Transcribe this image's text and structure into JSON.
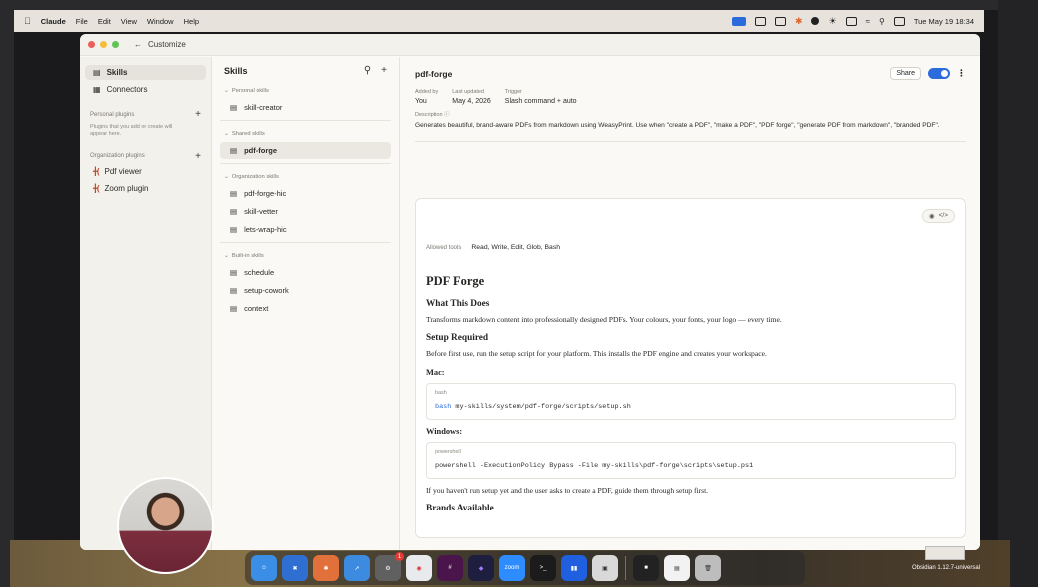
{
  "menubar": {
    "app_name": "Claude",
    "items": [
      "File",
      "Edit",
      "View",
      "Window",
      "Help"
    ],
    "clock": "Tue May 19  18:34"
  },
  "window": {
    "back_label": "Customize"
  },
  "nav": {
    "items": [
      {
        "label": "Skills",
        "icon": "skills-icon",
        "active": true
      },
      {
        "label": "Connectors",
        "icon": "connectors-icon",
        "active": false
      }
    ],
    "personal_plugins_label": "Personal plugins",
    "personal_plugins_note": "Plugins that you add or create will appear here.",
    "org_plugins_label": "Organization plugins",
    "org_plugins": [
      "Pdf viewer",
      "Zoom plugin"
    ]
  },
  "skills_panel": {
    "title": "Skills",
    "groups": [
      {
        "label": "Personal skills",
        "items": [
          "skill-creator"
        ]
      },
      {
        "label": "Shared skills",
        "items": [
          "pdf-forge"
        ]
      },
      {
        "label": "Organization skills",
        "items": [
          "pdf-forge-hic",
          "skill-vetter",
          "lets-wrap-hic"
        ]
      },
      {
        "label": "Built-in skills",
        "items": [
          "schedule",
          "setup-cowork",
          "context"
        ]
      }
    ],
    "selected": "pdf-forge"
  },
  "detail": {
    "title": "pdf-forge",
    "share_label": "Share",
    "enabled": true,
    "added_by_label": "Added by",
    "added_by": "You",
    "last_updated_label": "Last updated",
    "last_updated": "May 4, 2026",
    "trigger_label": "Trigger",
    "trigger": "Slash command + auto",
    "description_label": "Description",
    "description": "Generates beautiful, brand-aware PDFs from markdown using WeasyPrint. Use when \"create a PDF\", \"make a PDF\", \"PDF forge\", \"generate PDF from markdown\", \"branded PDF\".",
    "allowed_tools_label": "Allowed tools",
    "allowed_tools": "Read, Write, Edit, Glob, Bash",
    "doc": {
      "h1": "PDF Forge",
      "what_heading": "What This Does",
      "what_text": "Transforms markdown content into professionally designed PDFs. Your colours, your fonts, your logo — every time.",
      "setup_heading": "Setup Required",
      "setup_text": "Before first use, run the setup script for your platform. This installs the PDF engine and creates your workspace.",
      "mac_label": "Mac:",
      "mac_code_lang": "bash",
      "mac_code_cmd": "bash",
      "mac_code_rest": " my-skills/system/pdf-forge/scripts/setup.sh",
      "win_label": "Windows:",
      "win_code_lang": "powershell",
      "win_code": "powershell -ExecutionPolicy Bypass -File my-skills\\pdf-forge\\scripts\\setup.ps1",
      "after_text": "If you haven't run setup yet and the user asks to create a PDF, guide them through setup first.",
      "next_heading": "Brands Available"
    }
  },
  "dock": {
    "zoom_label": "zoom",
    "badge_count": "1"
  },
  "desktop": {
    "file_label": "Obsidian 1.12.7-universal"
  }
}
